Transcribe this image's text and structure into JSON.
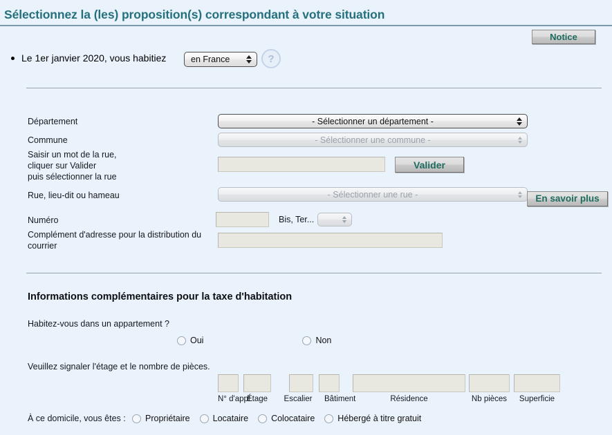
{
  "header": {
    "title": "Sélectionnez la (les) proposition(s) correspondant à votre situation",
    "notice_label": "Notice"
  },
  "intro": {
    "bullet_text": "Le 1er janvier 2020, vous habitiez",
    "country_value": "en France",
    "help_icon": "?"
  },
  "address_form": {
    "departement_label": "Département",
    "departement_value": "- Sélectionner un département -",
    "commune_label": "Commune",
    "commune_value": "- Sélectionner une commune -",
    "saisir_label": "Saisir un mot de la rue,\ncliquer sur Valider\npuis sélectionner la rue",
    "rue_search_value": "",
    "valider_label": "Valider",
    "rue_label": "Rue, lieu-dit ou hameau",
    "rue_value": "- Sélectionner une rue -",
    "en_savoir_plus_label": "En savoir plus",
    "numero_label": "Numéro",
    "numero_value": "",
    "bister_label": "Bis, Ter...",
    "bister_value": "",
    "complement_label": "Complément d'adresse pour la distribution du courrier",
    "complement_value": ""
  },
  "taxe_section": {
    "heading": "Informations complémentaires pour la taxe d'habitation",
    "appartement_question": "Habitez-vous dans un appartement ?",
    "appartement_options": [
      "Oui",
      "Non"
    ],
    "etage_question": "Veuillez signaler l'étage et le nombre de pièces.",
    "fields": [
      {
        "caption": "N° d'appt.",
        "value": ""
      },
      {
        "caption": "Étage",
        "value": ""
      },
      {
        "caption": "Escalier",
        "value": ""
      },
      {
        "caption": "Bâtiment",
        "value": ""
      },
      {
        "caption": "Résidence",
        "value": ""
      },
      {
        "caption": "Nb pièces",
        "value": ""
      },
      {
        "caption": "Superficie",
        "value": ""
      }
    ],
    "domicile_question": "À ce domicile, vous êtes :",
    "domicile_options": [
      "Propriétaire",
      "Locataire",
      "Colocataire",
      "Hébergé à titre gratuit"
    ]
  },
  "colors": {
    "background": "#eaf3fb",
    "title": "#25707e",
    "button_text": "#1d6b5e",
    "input_bg": "#e8e8e0",
    "rule": "#7e98ab"
  }
}
